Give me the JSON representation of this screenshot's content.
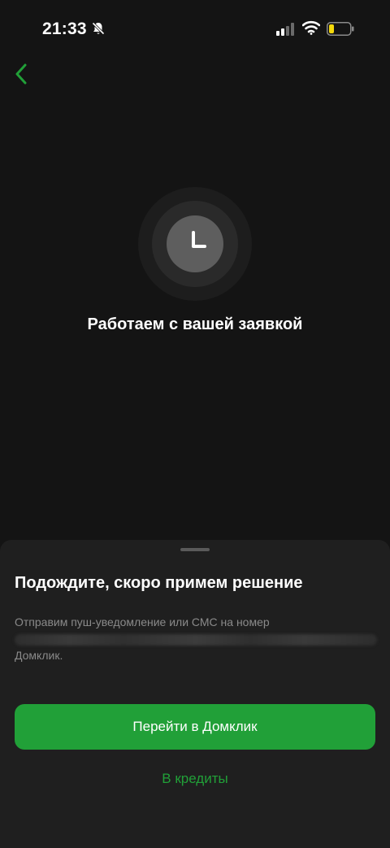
{
  "status_bar": {
    "time": "21:33",
    "icons": [
      "bell-slash-icon",
      "cellular-signal-icon",
      "wifi-icon",
      "battery-icon"
    ]
  },
  "nav": {
    "back_icon": "chevron-left-icon"
  },
  "status": {
    "icon": "clock-icon",
    "title": "Работаем с вашей заявкой"
  },
  "sheet": {
    "title": "Подождите, скоро примем решение",
    "text_start": "Отправим пуш-уведомление или СМС на номер",
    "text_end": "Домклик.",
    "primary_button": "Перейти в Домклик",
    "secondary_link": "В кредиты"
  },
  "colors": {
    "accent": "#21a038",
    "background": "#141414",
    "sheet": "#1f1f1f",
    "muted_text": "#8a8a8a",
    "battery_level": "#f5d90a"
  }
}
